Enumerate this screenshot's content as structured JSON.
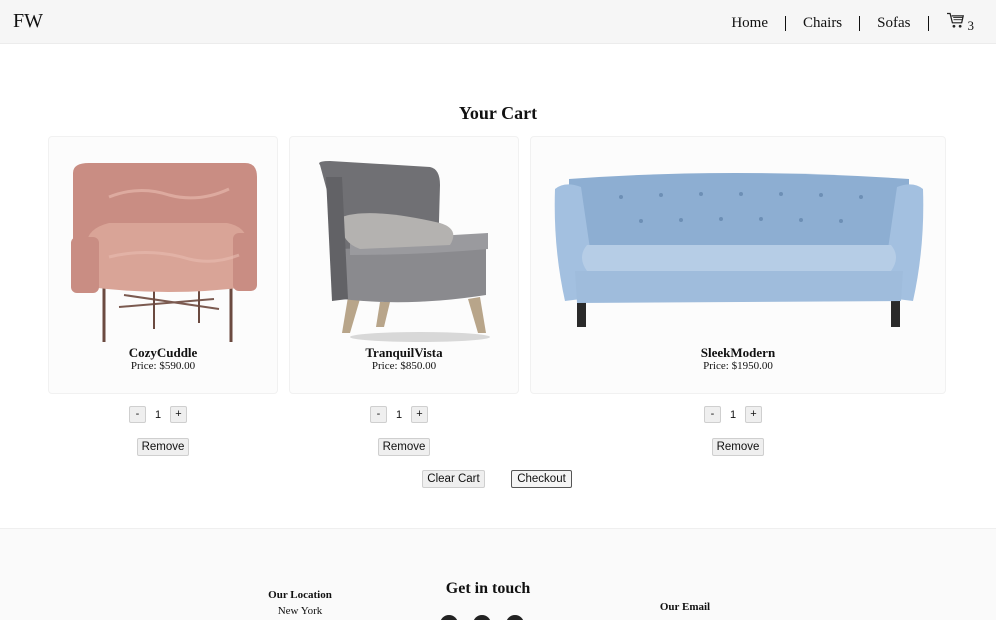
{
  "navbar": {
    "brand": "FW",
    "links": [
      "Home",
      "Chairs",
      "Sofas"
    ],
    "cart_count": "3"
  },
  "cart": {
    "title": "Your Cart",
    "items": [
      {
        "name": "CozyCuddle",
        "price": "Price: $590.00",
        "qty": "1"
      },
      {
        "name": "TranquilVista",
        "price": "Price: $850.00",
        "qty": "1"
      },
      {
        "name": "SleekModern",
        "price": "Price: $1950.00",
        "qty": "1"
      }
    ],
    "minus_label": "-",
    "plus_label": "+",
    "remove_label": "Remove",
    "clear_label": "Clear Cart",
    "checkout_label": "Checkout"
  },
  "footer": {
    "location_title": "Our Location",
    "location_city": "New York",
    "title": "Get in touch",
    "email_title": "Our Email"
  },
  "colors": {
    "nav_bg": "#f6f6f6",
    "pink_chair": "#d49a8e",
    "gray_chair": "#86868a",
    "blue_sofa": "#a9c3df"
  }
}
